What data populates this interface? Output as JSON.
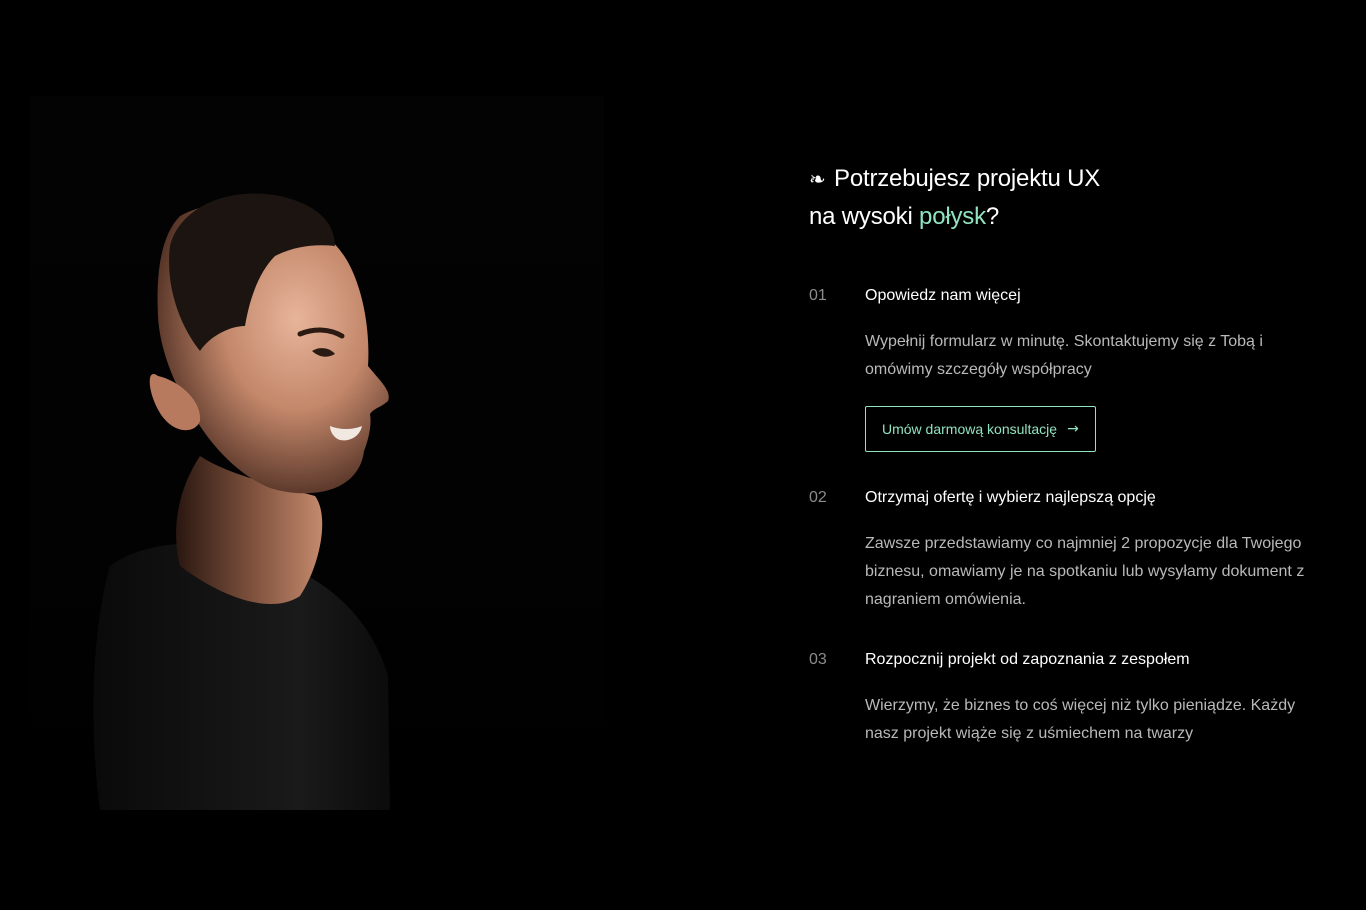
{
  "hero": {
    "glyph": "❧",
    "headline_line1": "Potrzebujesz projektu UX",
    "headline_line2_prefix": "na wysoki ",
    "headline_accent": "połysk",
    "headline_suffix": "?"
  },
  "steps": [
    {
      "number": "01",
      "title": "Opowiedz nam więcej",
      "text": "Wypełnij formularz w minutę. Skontaktujemy się z Tobą i omówimy szczegóły współpracy",
      "cta_label": "Umów darmową konsultację",
      "cta_icon": "→"
    },
    {
      "number": "02",
      "title": "Otrzymaj ofertę i wybierz najlepszą opcję",
      "text": "Zawsze przedstawiamy co najmniej 2 propozycje dla Twojego biznesu, omawiamy je na spotkaniu lub wysyłamy dokument z nagraniem omówienia."
    },
    {
      "number": "03",
      "title": "Rozpocznij projekt od zapoznania z zespołem",
      "text": "Wierzymy, że biznes to coś więcej niż tylko pieniądze. Każdy nasz projekt wiąże się z uśmiechem na twarzy"
    }
  ],
  "colors": {
    "background": "#000000",
    "accent": "#8fe3bf",
    "muted_text": "#b9b9b9",
    "step_number": "#8b8b8b"
  },
  "icons": {
    "cta_arrow": "arrow-right-icon",
    "headline_glyph": "floral-heart-icon"
  }
}
